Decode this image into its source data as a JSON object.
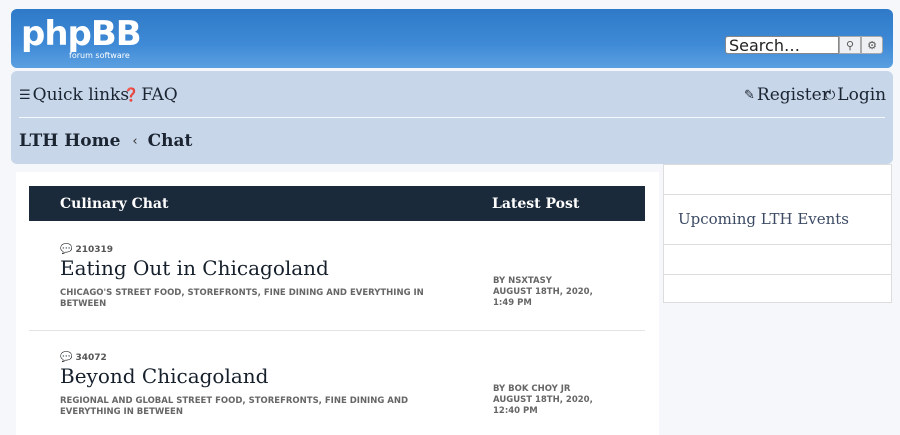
{
  "header": {
    "logo_text": "phpBB",
    "logo_subtext": "forum software",
    "search_placeholder": "Search…",
    "search_icon": "search-icon",
    "advanced_icon": "gear-icon",
    "brand_color": "#3a85d3"
  },
  "navbar": {
    "quick_links": "Quick links",
    "faq": "FAQ",
    "register": "Register",
    "login": "Login"
  },
  "breadcrumb": {
    "home": "LTH Home",
    "separator": "‹",
    "current": "Chat"
  },
  "forum_list": {
    "header_title": "Culinary Chat",
    "header_latest": "Latest Post",
    "forums": [
      {
        "topics": "210319",
        "title": "Eating Out in Chicagoland",
        "description": "Chicago's street food, storefronts, fine dining and everything in between",
        "last_post_by": "BY NSXTASY",
        "last_post_date": "AUGUST 18TH, 2020,",
        "last_post_time": "1:49 PM"
      },
      {
        "topics": "34072",
        "title": "Beyond Chicagoland",
        "description": "Regional and global street food, storefronts, fine dining and everything in between",
        "last_post_by": "BY BOK CHOY JR",
        "last_post_date": "AUGUST 18TH, 2020,",
        "last_post_time": "12:40 PM"
      }
    ]
  },
  "sidebar": {
    "events_title": "Upcoming LTH Events"
  }
}
